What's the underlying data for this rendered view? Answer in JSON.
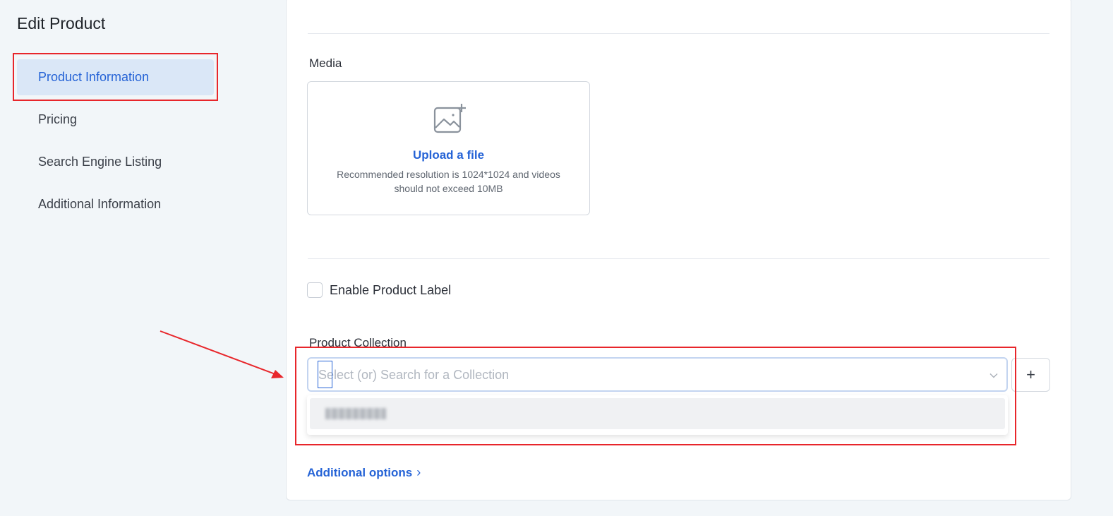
{
  "page": {
    "title": "Edit Product"
  },
  "sidebar": {
    "items": [
      {
        "label": "Product Information",
        "active": true
      },
      {
        "label": "Pricing",
        "active": false
      },
      {
        "label": "Search Engine Listing",
        "active": false
      },
      {
        "label": "Additional Information",
        "active": false
      }
    ]
  },
  "media": {
    "label": "Media",
    "icon": "image-add-icon",
    "upload_label": "Upload a file",
    "hint": "Recommended resolution is 1024*1024 and videos should not exceed 10MB"
  },
  "product_label": {
    "checkbox_label": "Enable Product Label",
    "checked": false
  },
  "collection": {
    "label": "Product Collection",
    "placeholder": "Select (or) Search for a Collection",
    "add_button": "+",
    "dropdown_open": true,
    "option_text_obscured": true
  },
  "additional_options": {
    "label": "Additional options",
    "icon": "chevron-right-icon"
  },
  "colors": {
    "accent": "#2563d6",
    "active_nav_bg": "#dae7f7",
    "annotation_red": "#e8262b"
  }
}
